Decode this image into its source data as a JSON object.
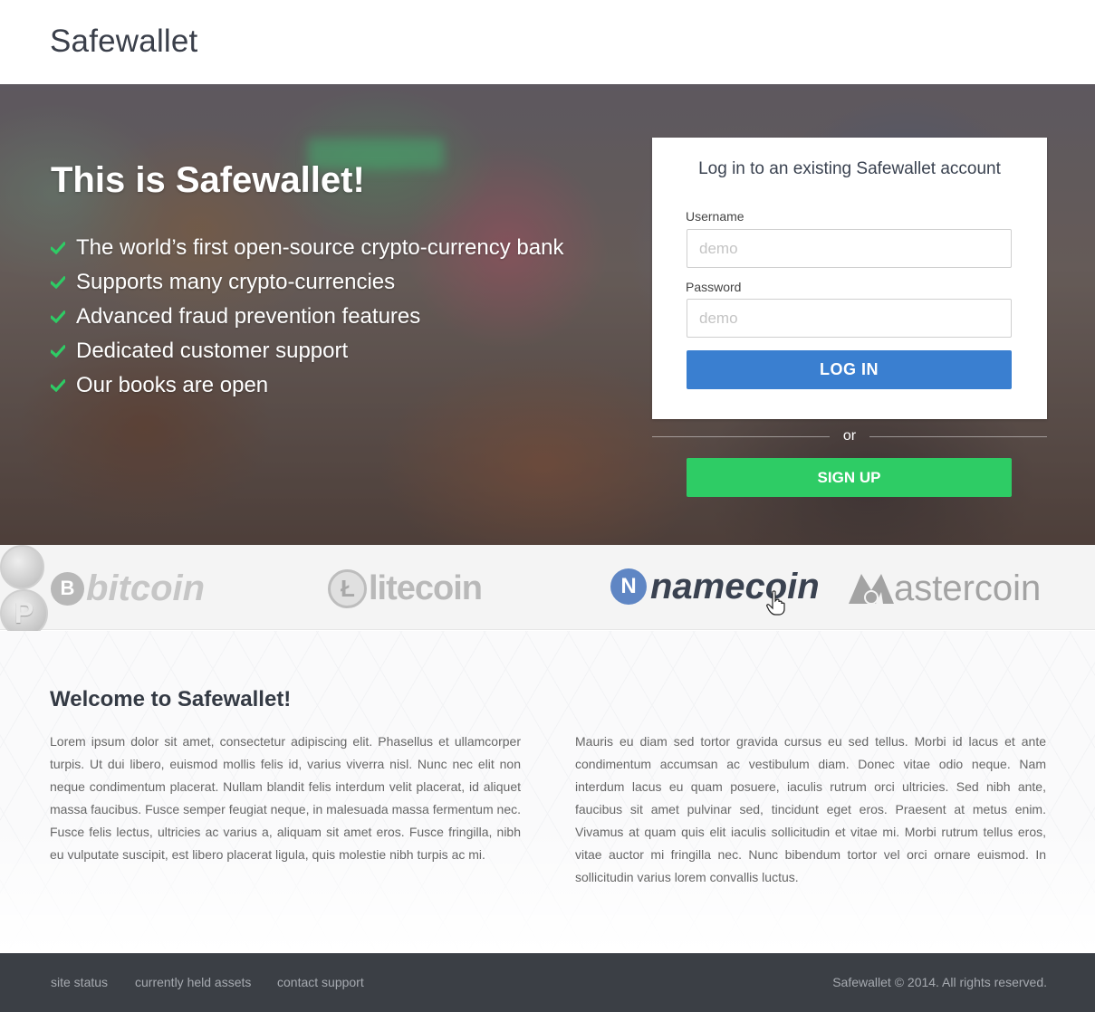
{
  "header": {
    "brand": "Safewallet"
  },
  "hero": {
    "title": "This is Safewallet!",
    "features": [
      "The world’s first open-source crypto-currency bank",
      "Supports many crypto-currencies",
      "Advanced fraud prevention features",
      "Dedicated customer support",
      "Our books are open"
    ],
    "accent_check_color": "#2ecc65"
  },
  "login": {
    "title": "Log in to an existing Safewallet account",
    "username_label": "Username",
    "username_placeholder": "demo",
    "password_label": "Password",
    "password_placeholder": "demo",
    "login_button": "LOG IN",
    "login_color": "#3a7fd0",
    "or_text": "or",
    "signup_button": "SIGN UP",
    "signup_color": "#2ecc65"
  },
  "coins": {
    "bitcoin": "bitcoin",
    "bitcoin_symbol": "B",
    "litecoin": "litecoin",
    "litecoin_symbol": "Ł",
    "peercoin_symbol": "P",
    "namecoin": "namecoin",
    "namecoin_symbol": "N",
    "mastercoin": "astercoin"
  },
  "welcome": {
    "title": "Welcome to Safewallet!",
    "paragraph_left": "Lorem ipsum dolor sit amet, consectetur adipiscing elit. Phasellus et ullamcorper turpis. Ut dui libero, euismod mollis felis id, varius viverra nisl. Nunc nec elit non neque condimentum placerat. Nullam blandit felis interdum velit placerat, id aliquet massa faucibus. Fusce semper feugiat neque, in malesuada massa fermentum nec. Fusce felis lectus, ultricies ac varius a, aliquam sit amet eros. Fusce fringilla, nibh eu vulputate suscipit, est libero placerat ligula, quis molestie nibh turpis ac mi.",
    "paragraph_right": "Mauris eu diam sed tortor gravida cursus eu sed tellus. Morbi id lacus et ante condimentum accumsan ac vestibulum diam. Donec vitae odio neque. Nam interdum lacus eu quam posuere, iaculis rutrum orci ultricies. Sed nibh ante, faucibus sit amet pulvinar sed, tincidunt eget eros. Praesent at metus enim. Vivamus at quam quis elit iaculis sollicitudin et vitae mi. Morbi rutrum tellus eros, vitae auctor mi fringilla nec. Nunc bibendum tortor vel orci ornare euismod. In sollicitudin varius lorem convallis luctus."
  },
  "footer": {
    "links": [
      "site status",
      "currently held assets",
      "contact support"
    ],
    "copyright": "Safewallet © 2014. All rights reserved."
  }
}
